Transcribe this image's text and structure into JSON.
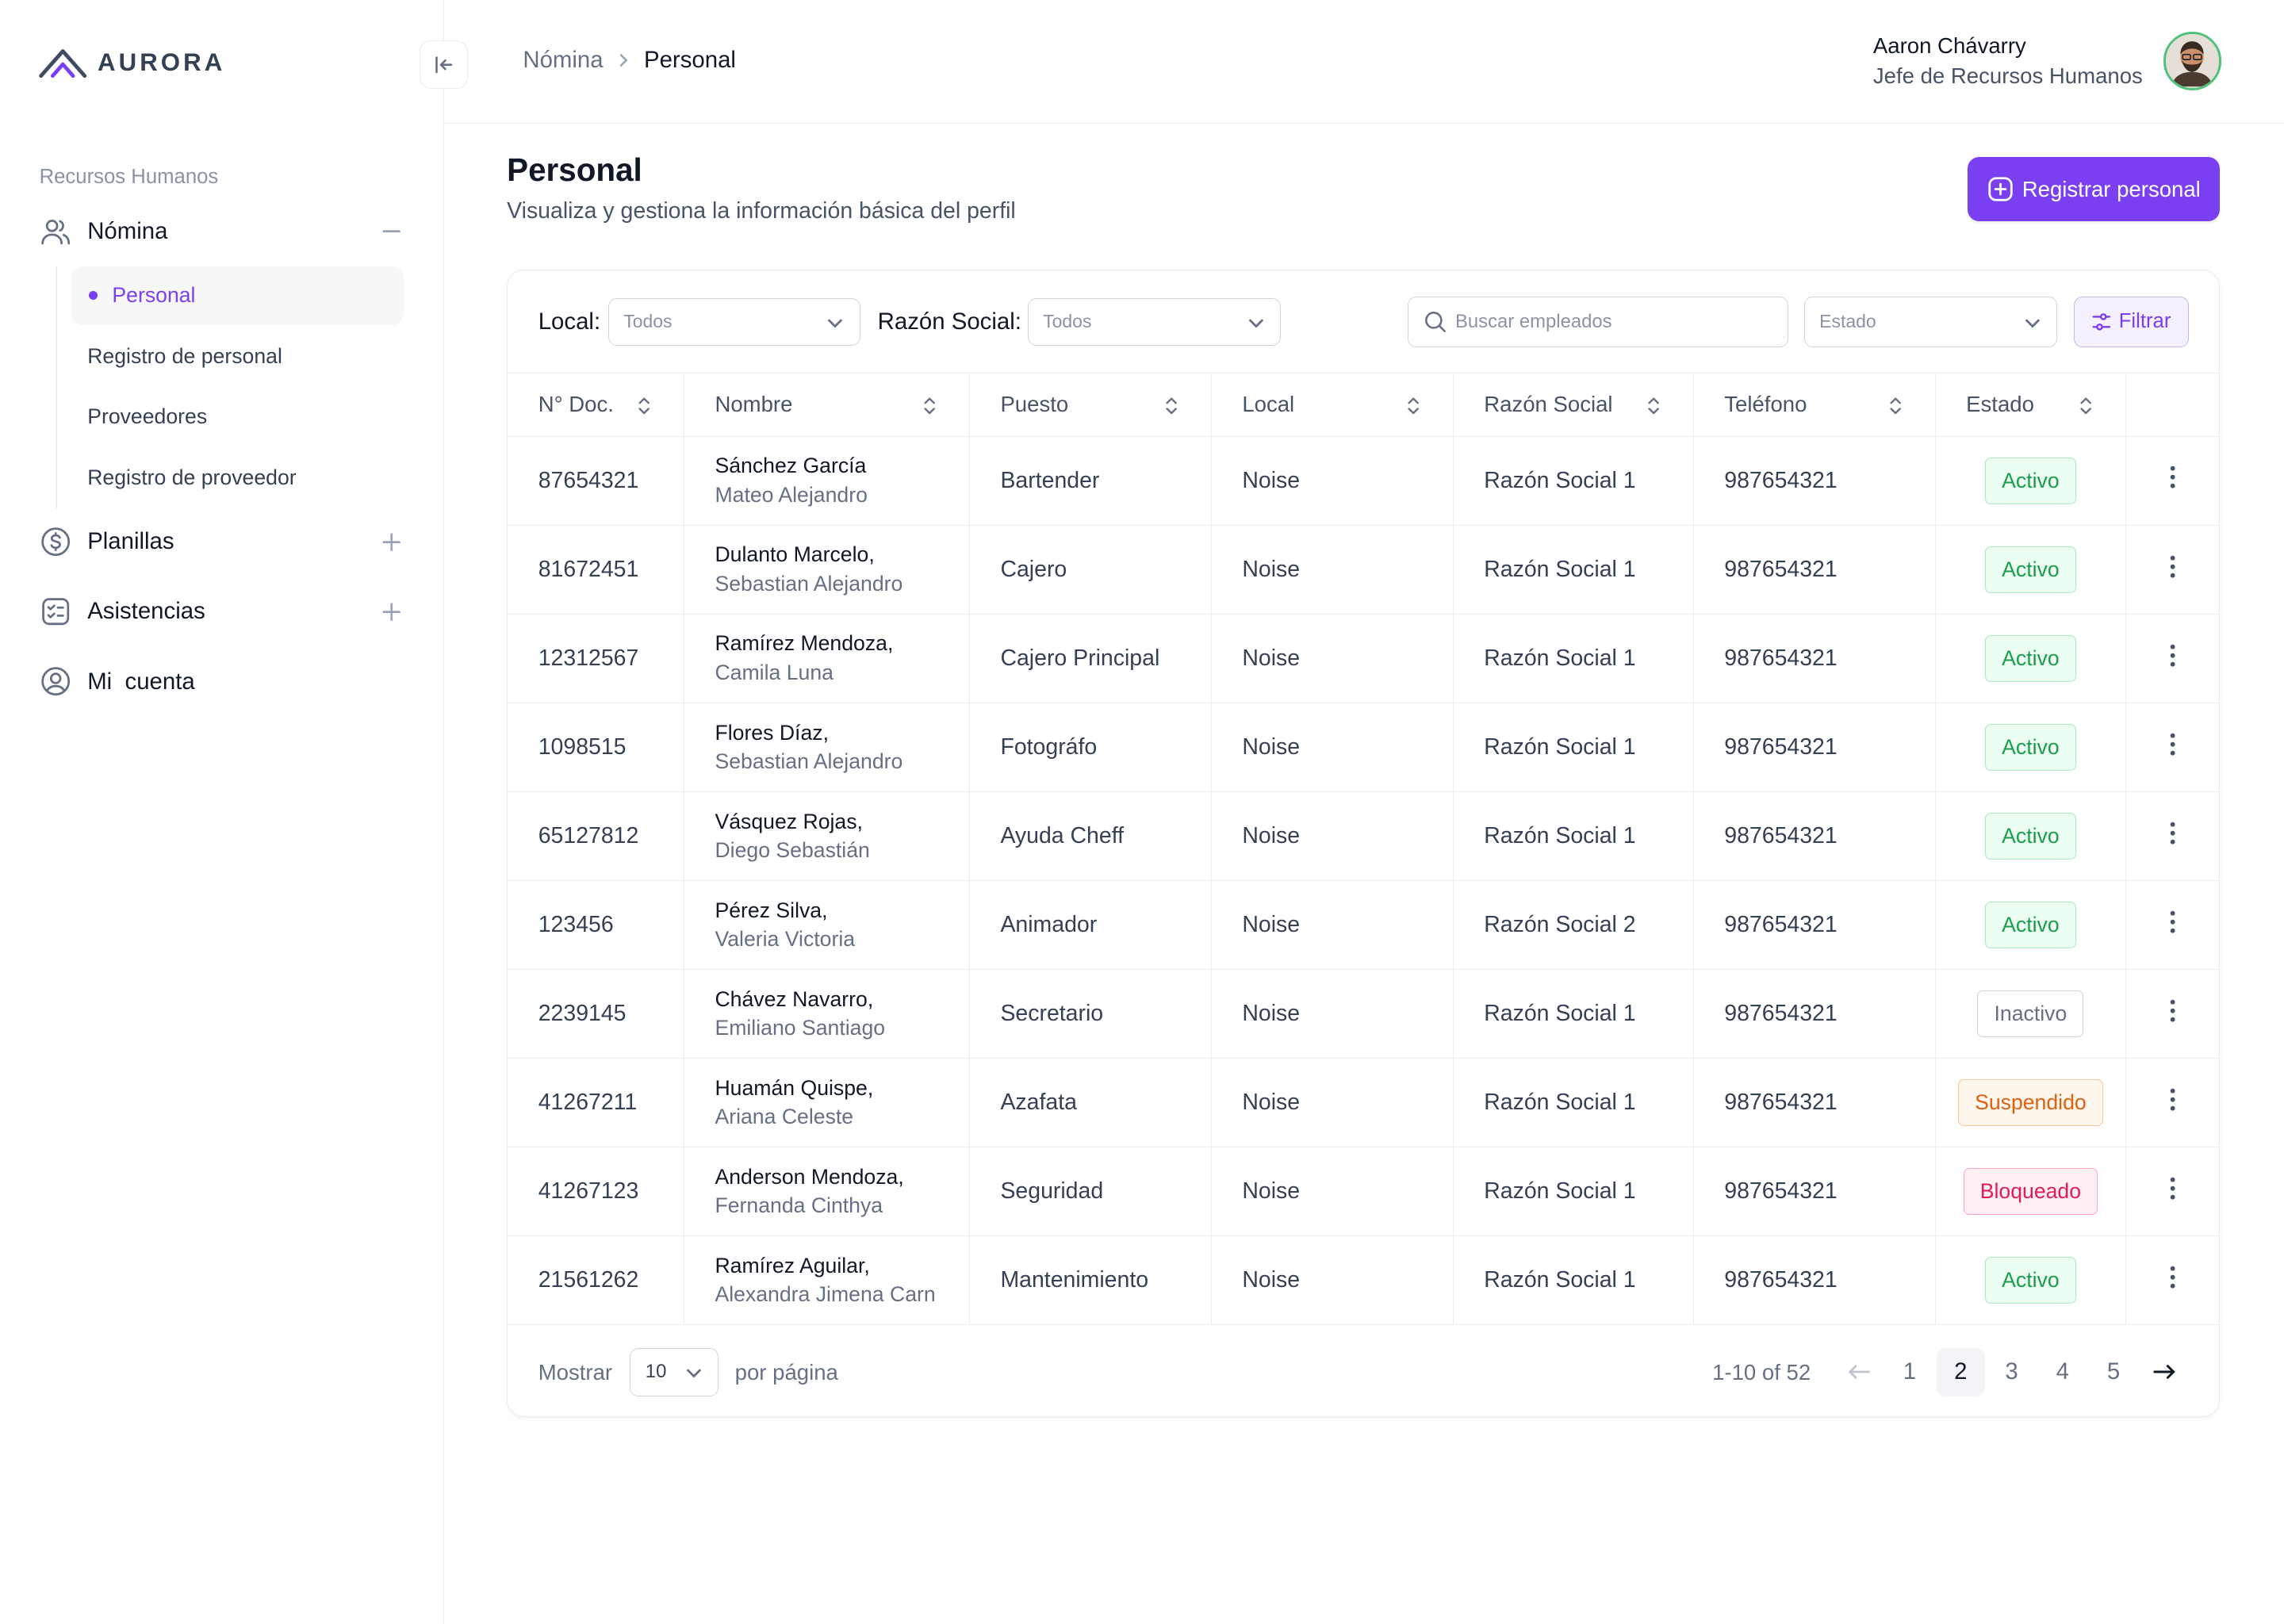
{
  "brand": {
    "name": "AURORA"
  },
  "sidebar": {
    "section": "Recursos Humanos",
    "nomina": "Nómina",
    "sub_items": [
      "Personal",
      "Registro de personal",
      "Proveedores",
      "Registro de proveedor"
    ],
    "planillas": "Planillas",
    "asistencias": "Asistencias",
    "cuenta": "Mi  cuenta"
  },
  "header": {
    "breadcrumb": [
      "Nómina",
      "Personal"
    ],
    "user_name": "Aaron Chávarry",
    "user_role": "Jefe de Recursos Humanos"
  },
  "page": {
    "title": "Personal",
    "subtitle": "Visualiza y gestiona la información básica del perfil",
    "primary_button": "Registrar personal"
  },
  "filters": {
    "local_label": "Local:",
    "local_value": "Todos",
    "razon_label": "Razón Social:",
    "razon_value": "Todos",
    "search_placeholder": "Buscar empleados",
    "estado_placeholder": "Estado",
    "filter_button": "Filtrar"
  },
  "table": {
    "columns": [
      "N° Doc.",
      "Nombre",
      "Puesto",
      "Local",
      "Razón Social",
      "Teléfono",
      "Estado"
    ],
    "rows": [
      {
        "doc": "87654321",
        "name1": "Sánchez García",
        "name2": "Mateo Alejandro",
        "puesto": "Bartender",
        "local": "Noise",
        "razon": "Razón Social 1",
        "tel": "987654321",
        "estado": "Activo",
        "estado_color": "green"
      },
      {
        "doc": "81672451",
        "name1": "Dulanto Marcelo,",
        "name2": "Sebastian Alejandro",
        "puesto": "Cajero",
        "local": "Noise",
        "razon": "Razón Social 1",
        "tel": "987654321",
        "estado": "Activo",
        "estado_color": "green"
      },
      {
        "doc": "12312567",
        "name1": "Ramírez Mendoza,",
        "name2": "Camila Luna",
        "puesto": "Cajero Principal",
        "local": "Noise",
        "razon": "Razón Social 1",
        "tel": "987654321",
        "estado": "Activo",
        "estado_color": "green"
      },
      {
        "doc": "1098515",
        "name1": "Flores Díaz,",
        "name2": "Sebastian Alejandro",
        "puesto": "Fotográfo",
        "local": "Noise",
        "razon": "Razón Social 1",
        "tel": "987654321",
        "estado": "Activo",
        "estado_color": "green"
      },
      {
        "doc": "65127812",
        "name1": "Vásquez Rojas,",
        "name2": "Diego Sebastián",
        "puesto": "Ayuda Cheff",
        "local": "Noise",
        "razon": "Razón Social 1",
        "tel": "987654321",
        "estado": "Activo",
        "estado_color": "green"
      },
      {
        "doc": "123456",
        "name1": "Pérez Silva,",
        "name2": "Valeria Victoria",
        "puesto": "Animador",
        "local": "Noise",
        "razon": "Razón Social 2",
        "tel": "987654321",
        "estado": "Activo",
        "estado_color": "green"
      },
      {
        "doc": "2239145",
        "name1": "Chávez Navarro,",
        "name2": "Emiliano Santiago",
        "puesto": "Secretario",
        "local": "Noise",
        "razon": "Razón Social 1",
        "tel": "987654321",
        "estado": "Inactivo",
        "estado_color": "gray"
      },
      {
        "doc": "41267211",
        "name1": "Huamán Quispe,",
        "name2": "Ariana Celeste",
        "puesto": "Azafata",
        "local": "Noise",
        "razon": "Razón Social 1",
        "tel": "987654321",
        "estado": "Suspendido",
        "estado_color": "orange"
      },
      {
        "doc": "41267123",
        "name1": "Anderson Mendoza,",
        "name2": "Fernanda Cinthya",
        "puesto": "Seguridad",
        "local": "Noise",
        "razon": "Razón Social 1",
        "tel": "987654321",
        "estado": "Bloqueado",
        "estado_color": "red"
      },
      {
        "doc": "21561262",
        "name1": "Ramírez Aguilar,",
        "name2": "Alexandra Jimena Carn",
        "puesto": "Mantenimiento",
        "local": "Noise",
        "razon": "Razón Social 1",
        "tel": "987654321",
        "estado": "Activo",
        "estado_color": "green"
      }
    ]
  },
  "pagination": {
    "show_label": "Mostrar",
    "per_page": "10",
    "per_page_label": "por página",
    "range": "1-10 of 52",
    "pages": [
      "1",
      "2",
      "3",
      "4",
      "5"
    ],
    "current": "2"
  },
  "colors": {
    "accent": "#7b3ff2",
    "active": "#1a9e4b",
    "suspended": "#e0600f",
    "blocked": "#e31b54"
  }
}
